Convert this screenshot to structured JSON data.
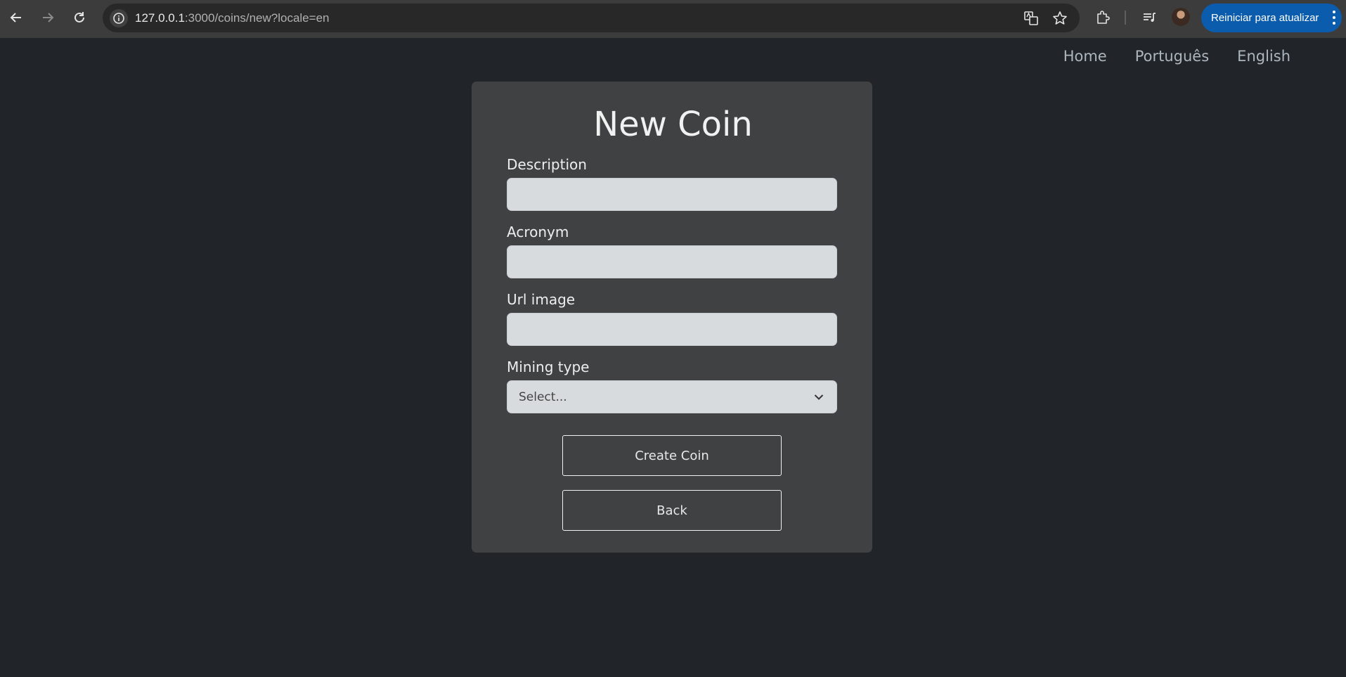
{
  "browser": {
    "url_host": "127.0.0.1",
    "url_rest": ":3000/coins/new?locale=en",
    "update_button_label": "Reiniciar para atualizar",
    "icons": [
      "back-arrow-icon",
      "forward-arrow-icon",
      "reload-icon",
      "site-info-icon",
      "translate-icon",
      "bookmark-star-icon",
      "extensions-icon",
      "media-control-icon",
      "profile-avatar",
      "more-menu-icon"
    ]
  },
  "nav": {
    "home": "Home",
    "portuguese": "Português",
    "english": "English"
  },
  "form": {
    "title": "New Coin",
    "description_label": "Description",
    "description_value": "",
    "acronym_label": "Acronym",
    "acronym_value": "",
    "url_image_label": "Url image",
    "url_image_value": "",
    "mining_type_label": "Mining type",
    "mining_type_selected": "Select...",
    "submit_label": "Create Coin",
    "back_label": "Back"
  },
  "colors": {
    "page_background": "#212529",
    "card_background": "#404143",
    "input_background": "#d8dbdd",
    "update_button": "#0b5cad"
  }
}
